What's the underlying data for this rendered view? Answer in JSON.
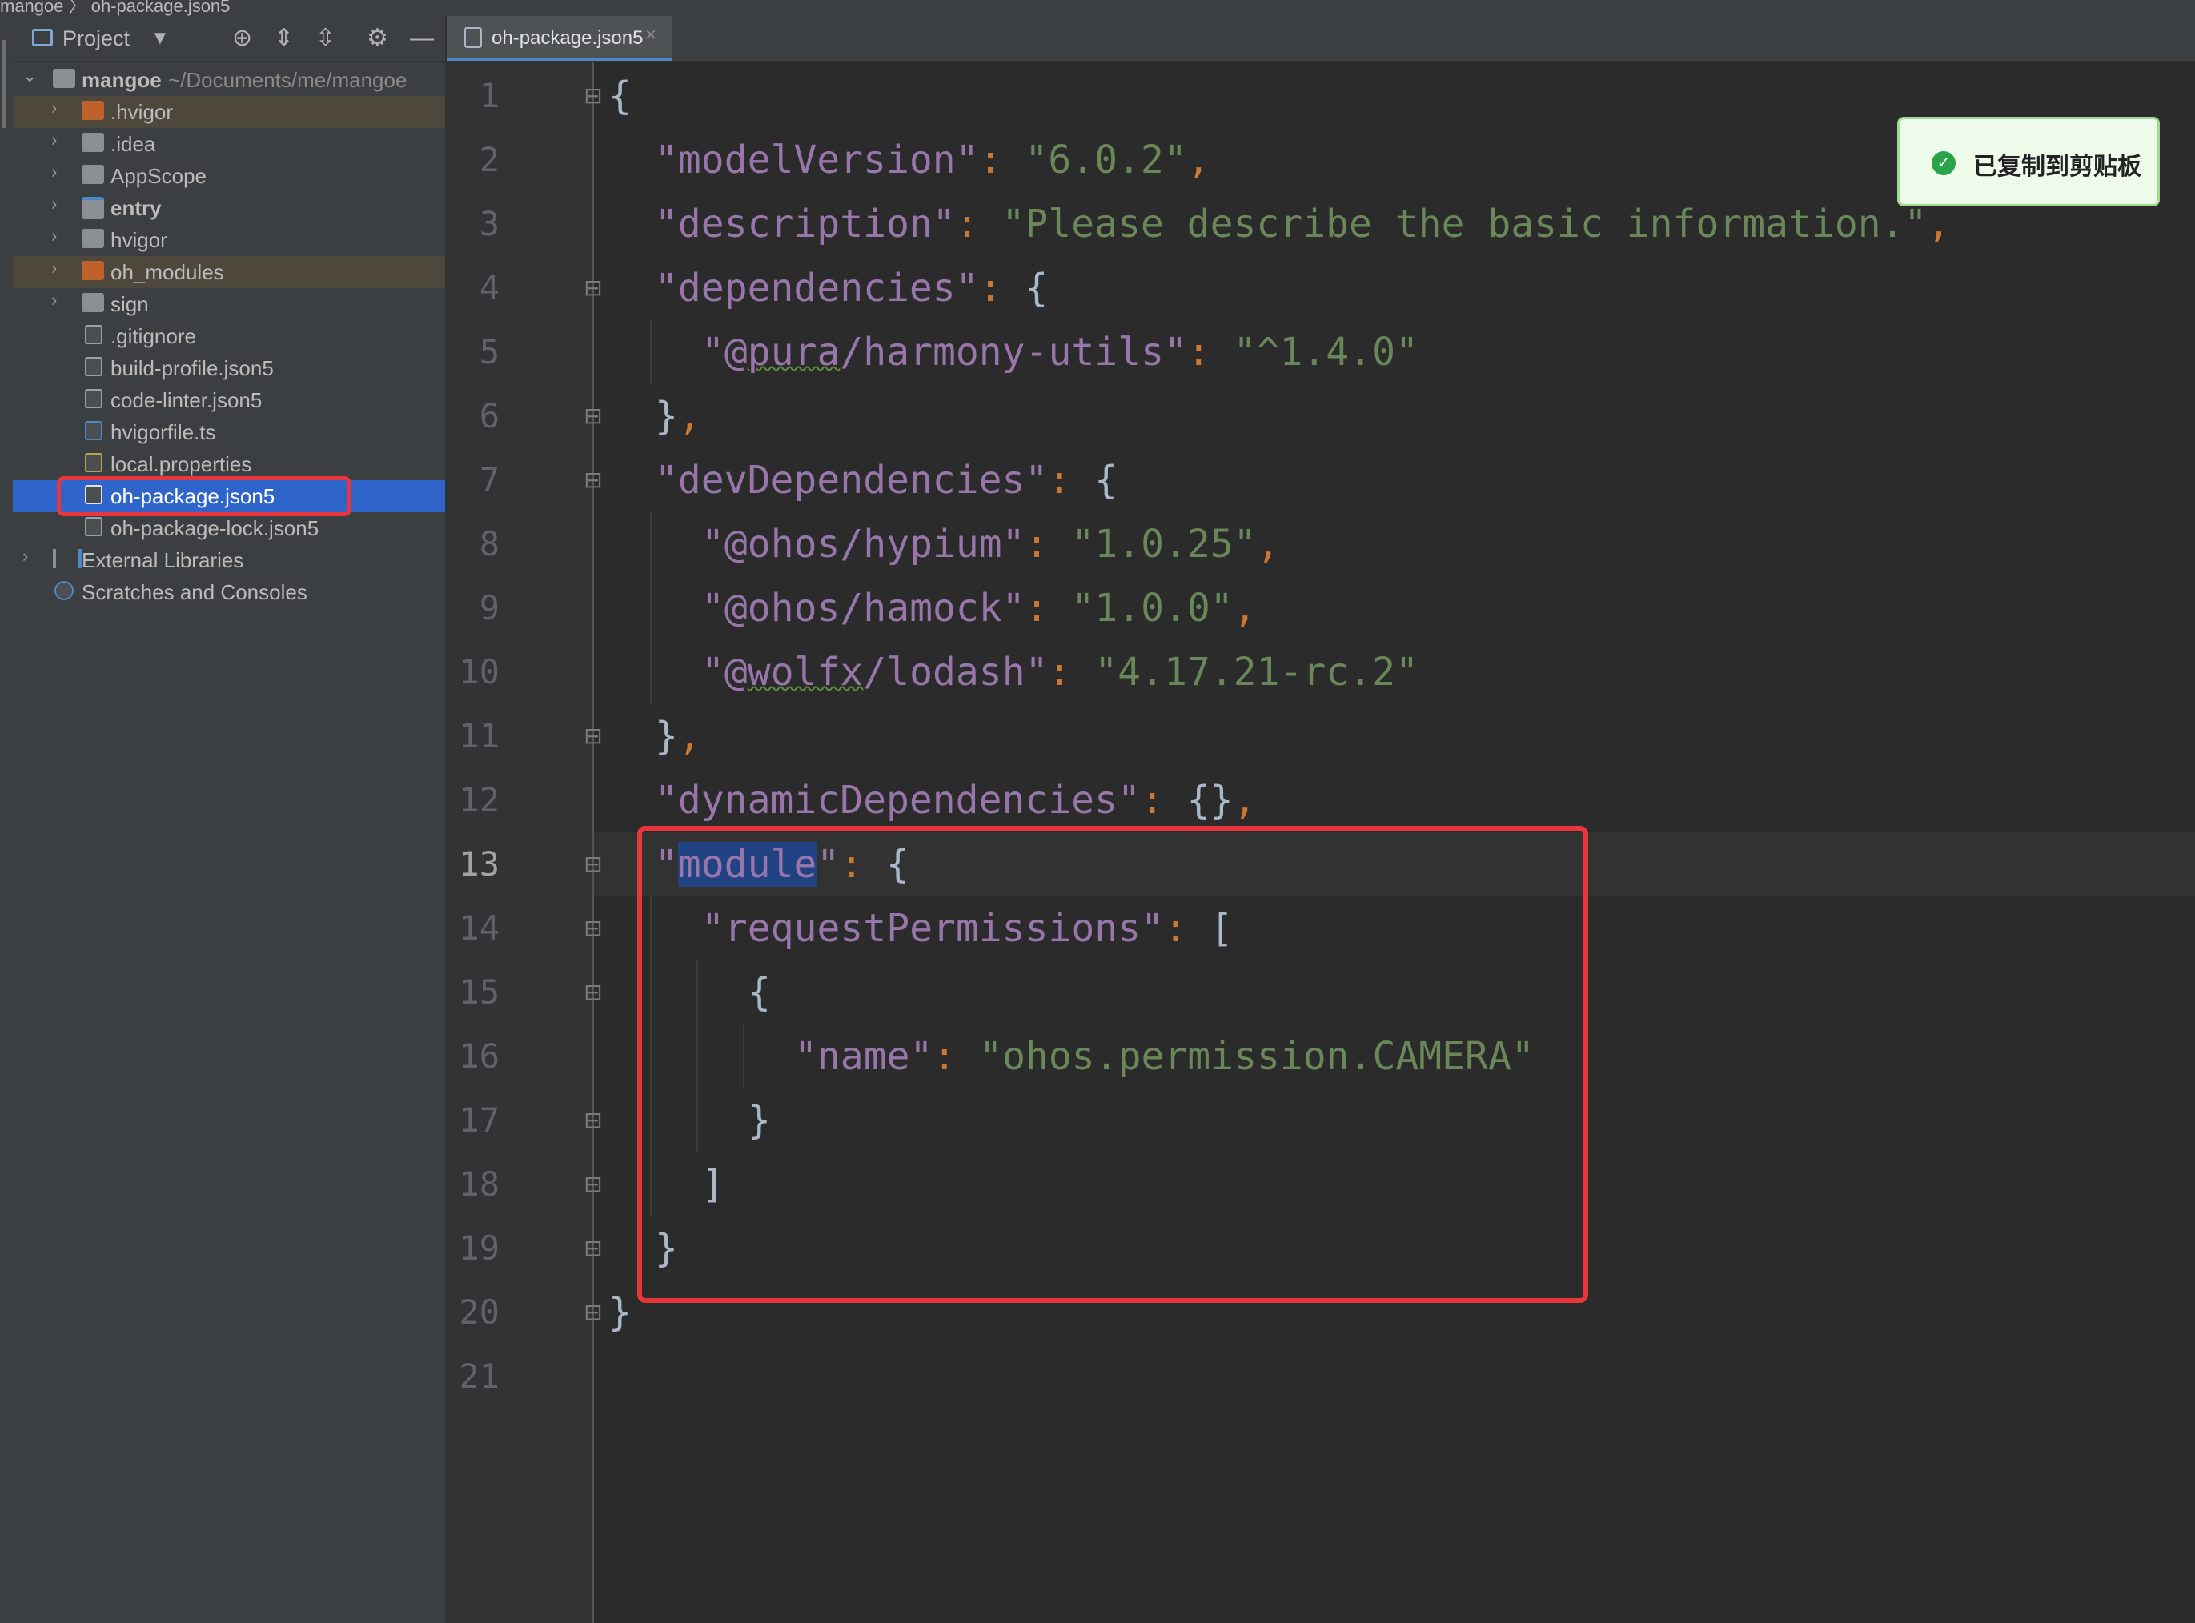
{
  "breadcrumb": {
    "text": "mangoe 〉 oh-package.json5"
  },
  "project_panel": {
    "title": "Project",
    "toolbar_icons": [
      "locate-icon",
      "expand-all-icon",
      "collapse-all-icon",
      "gear-icon",
      "hide-icon"
    ],
    "root": {
      "name": "mangoe",
      "path": "~/Documents/me/mangoe"
    },
    "items": [
      {
        "label": ".hvigor",
        "type": "folder-excluded",
        "expandable": true
      },
      {
        "label": ".idea",
        "type": "folder",
        "expandable": true
      },
      {
        "label": "AppScope",
        "type": "folder",
        "expandable": true
      },
      {
        "label": "entry",
        "type": "module",
        "expandable": true
      },
      {
        "label": "hvigor",
        "type": "folder",
        "expandable": true
      },
      {
        "label": "oh_modules",
        "type": "folder-excluded",
        "expandable": true
      },
      {
        "label": "sign",
        "type": "folder",
        "expandable": true
      },
      {
        "label": ".gitignore",
        "type": "file"
      },
      {
        "label": "build-profile.json5",
        "type": "file"
      },
      {
        "label": "code-linter.json5",
        "type": "file"
      },
      {
        "label": "hvigorfile.ts",
        "type": "file"
      },
      {
        "label": "local.properties",
        "type": "file"
      },
      {
        "label": "oh-package.json5",
        "type": "file",
        "selected": true
      },
      {
        "label": "oh-package-lock.json5",
        "type": "file"
      }
    ],
    "external_libraries": "External Libraries",
    "scratches": "Scratches and Consoles"
  },
  "editor": {
    "tab": {
      "label": "oh-package.json5",
      "close": "×"
    },
    "current_line": 13,
    "line_numbers": [
      "1",
      "2",
      "3",
      "4",
      "5",
      "6",
      "7",
      "8",
      "9",
      "10",
      "11",
      "12",
      "13",
      "14",
      "15",
      "16",
      "17",
      "18",
      "19",
      "20",
      "21"
    ],
    "code": {
      "l1_brace": "{",
      "l2_key": "\"modelVersion\"",
      "l2_val": "\"6.0.2\"",
      "l3_key": "\"description\"",
      "l3_val": "\"Please describe the basic information.\"",
      "l4_key": "\"dependencies\"",
      "l5_key_q": "\"@",
      "l5_key_ul": "pura",
      "l5_key_rest": "/harmony-utils\"",
      "l5_val": "\"^1.4.0\"",
      "l7_key": "\"devDependencies\"",
      "l8_key": "\"@ohos/hypium\"",
      "l8_val": "\"1.0.25\"",
      "l9_key": "\"@ohos/hamock\"",
      "l9_val": "\"1.0.0\"",
      "l10_key_q": "\"@",
      "l10_key_ul": "wolfx",
      "l10_key_rest": "/lodash\"",
      "l10_val": "\"4.17.21-rc.2\"",
      "l12_key": "\"dynamicDependencies\"",
      "l12_val": "{}",
      "l13_q1": "\"",
      "l13_word": "module",
      "l13_q2": "\"",
      "l14_key": "\"requestPermissions\"",
      "l16_key": "\"name\"",
      "l16_val": "\"ohos.permission.CAMERA\""
    }
  },
  "toast": {
    "message": "已复制到剪贴板",
    "icon": "check-circle-icon",
    "color": "#2aa34a"
  },
  "colors": {
    "key": "#9876aa",
    "string": "#6a8759",
    "punctuation": "#cc7832",
    "highlight_box": "#e8363c",
    "selection": "#2f65ca"
  }
}
